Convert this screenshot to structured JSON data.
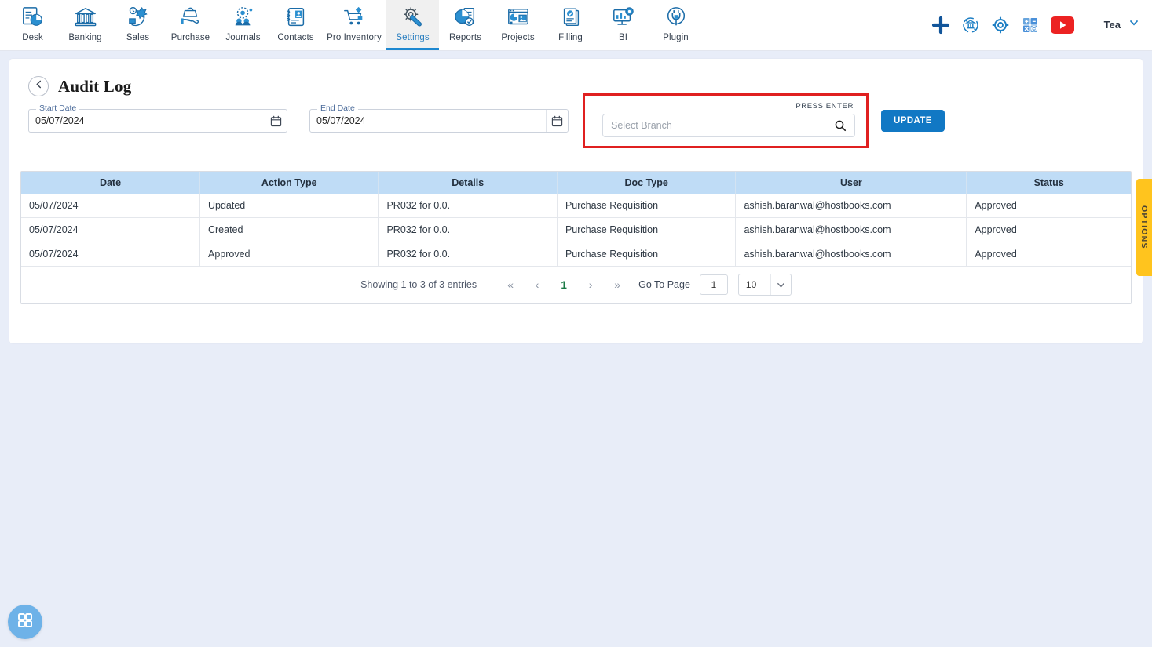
{
  "nav": {
    "items": [
      {
        "label": "Desk",
        "icon": "desk-icon",
        "active": false
      },
      {
        "label": "Banking",
        "icon": "bank-icon",
        "active": false
      },
      {
        "label": "Sales",
        "icon": "sales-icon",
        "active": false
      },
      {
        "label": "Purchase",
        "icon": "purchase-icon",
        "active": false
      },
      {
        "label": "Journals",
        "icon": "journals-icon",
        "active": false
      },
      {
        "label": "Contacts",
        "icon": "contacts-icon",
        "active": false
      },
      {
        "label": "Pro Inventory",
        "icon": "inventory-icon",
        "active": false
      },
      {
        "label": "Settings",
        "icon": "settings-gear-wrench-icon",
        "active": true
      },
      {
        "label": "Reports",
        "icon": "reports-piechart-icon",
        "active": false
      },
      {
        "label": "Projects",
        "icon": "projects-icon",
        "active": false
      },
      {
        "label": "Filling",
        "icon": "filling-docs-icon",
        "active": false
      },
      {
        "label": "BI",
        "icon": "bi-monitor-icon",
        "active": false
      },
      {
        "label": "Plugin",
        "icon": "plugin-plug-icon",
        "active": false
      }
    ],
    "right_icons": [
      {
        "name": "add-plus-icon",
        "color": "#1565a8"
      },
      {
        "name": "bank-sync-icon",
        "color": "#1e7fc4"
      },
      {
        "name": "gear-icon",
        "color": "#1e7fc4"
      },
      {
        "name": "calculator-icon",
        "color": "#4a90d9"
      },
      {
        "name": "youtube-icon",
        "color": "#ec2222"
      }
    ],
    "user": {
      "name": "Tea",
      "caret": "chevron-down-icon"
    }
  },
  "header": {
    "back_icon": "chevron-left-icon",
    "title": "Audit Log"
  },
  "filters": {
    "start_date": {
      "label": "Start Date",
      "value": "05/07/2024",
      "icon": "calendar-icon"
    },
    "end_date": {
      "label": "End Date",
      "value": "05/07/2024",
      "icon": "calendar-icon"
    },
    "branch": {
      "hint": "PRESS ENTER",
      "placeholder": "Select Branch",
      "value": "",
      "icon": "search-icon"
    },
    "update_label": "UPDATE",
    "highlight_color": "#e02020"
  },
  "table": {
    "columns": [
      "Date",
      "Action Type",
      "Details",
      "Doc Type",
      "User",
      "Status"
    ],
    "rows": [
      {
        "date": "05/07/2024",
        "action_type": "Updated",
        "details": "PR032 for 0.0.",
        "doc_type": "Purchase Requisition",
        "user": "ashish.baranwal@hostbooks.com",
        "status": "Approved"
      },
      {
        "date": "05/07/2024",
        "action_type": "Created",
        "details": "PR032 for 0.0.",
        "doc_type": "Purchase Requisition",
        "user": "ashish.baranwal@hostbooks.com",
        "status": "Approved"
      },
      {
        "date": "05/07/2024",
        "action_type": "Approved",
        "details": "PR032 for 0.0.",
        "doc_type": "Purchase Requisition",
        "user": "ashish.baranwal@hostbooks.com",
        "status": "Approved"
      }
    ]
  },
  "pagination": {
    "showing": "Showing 1 to 3 of 3 entries",
    "first_label": "«",
    "prev_label": "‹",
    "current_page": "1",
    "next_label": "›",
    "last_label": "»",
    "goto_label": "Go To Page",
    "goto_value": "1",
    "page_size": "10",
    "page_size_caret": "chevron-down-icon"
  },
  "options_tab": {
    "label": "OPTIONS",
    "color": "#ffc41e"
  },
  "fab": {
    "icon": "grid-apps-icon",
    "color": "#6eb2e8"
  }
}
